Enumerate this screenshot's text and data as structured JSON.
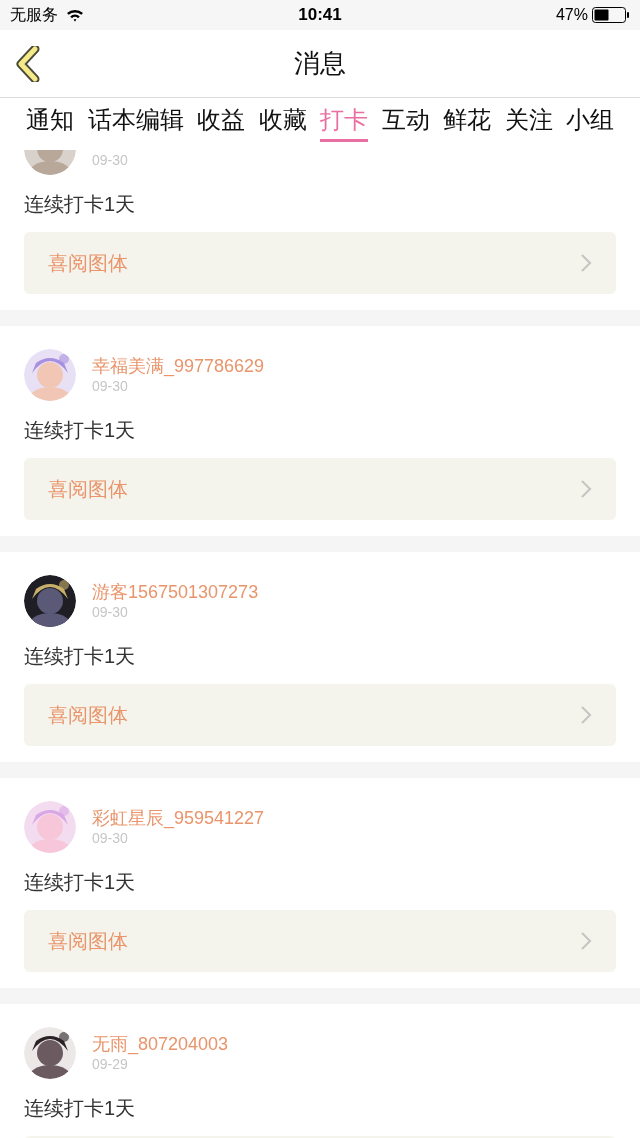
{
  "status_bar": {
    "carrier": "无服务",
    "time": "10:41",
    "battery": "47%"
  },
  "header": {
    "title": "消息"
  },
  "tabs": [
    {
      "label": "通知",
      "selected": false
    },
    {
      "label": "话本编辑",
      "selected": false
    },
    {
      "label": "收益",
      "selected": false
    },
    {
      "label": "收藏",
      "selected": false
    },
    {
      "label": "打卡",
      "selected": true
    },
    {
      "label": "互动",
      "selected": false
    },
    {
      "label": "鲜花",
      "selected": false
    },
    {
      "label": "关注",
      "selected": false
    },
    {
      "label": "小组",
      "selected": false
    }
  ],
  "posts": [
    {
      "date": "09-30",
      "text": "连续打卡1天",
      "book": "喜阅图体"
    },
    {
      "user": "幸福美满_997786629",
      "date": "09-30",
      "text": "连续打卡1天",
      "book": "喜阅图体"
    },
    {
      "user": "游客1567501307273",
      "date": "09-30",
      "text": "连续打卡1天",
      "book": "喜阅图体"
    },
    {
      "user": "彩虹星辰_959541227",
      "date": "09-30",
      "text": "连续打卡1天",
      "book": "喜阅图体"
    },
    {
      "user": "无雨_807204003",
      "date": "09-29",
      "text": "连续打卡1天"
    }
  ]
}
